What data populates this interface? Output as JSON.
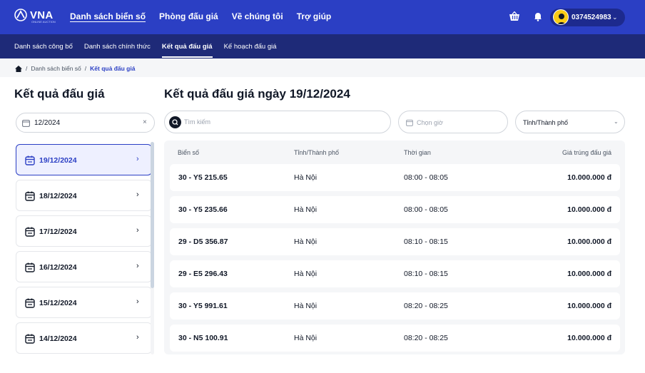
{
  "brand": {
    "name": "VNA",
    "tagline": "ONLINE AUCTION"
  },
  "topnav": [
    {
      "label": "Danh sách biển số",
      "active": true
    },
    {
      "label": "Phòng đấu giá",
      "active": false
    },
    {
      "label": "Về chúng tôi",
      "active": false
    },
    {
      "label": "Trợ giúp",
      "active": false
    }
  ],
  "user": {
    "phone": "0374524983",
    "caret": "⌄"
  },
  "subnav": [
    {
      "label": "Danh sách công bố",
      "active": false
    },
    {
      "label": "Danh sách chính thức",
      "active": false
    },
    {
      "label": "Kết quả đấu giá",
      "active": true
    },
    {
      "label": "Kế hoạch đấu giá",
      "active": false
    }
  ],
  "breadcrumb": {
    "sep": "/",
    "items": [
      "Danh sách biển số",
      "Kết quả đấu giá"
    ]
  },
  "left": {
    "title": "Kết quả đấu giá",
    "month_filter": "12/2024",
    "clear": "×",
    "dates": [
      "19/12/2024",
      "18/12/2024",
      "17/12/2024",
      "16/12/2024",
      "15/12/2024",
      "14/12/2024"
    ],
    "selected_index": 0
  },
  "main": {
    "title": "Kết quả đấu giá ngày 19/12/2024",
    "search_placeholder": "Tìm kiếm",
    "time_placeholder": "Chọn giờ",
    "city_select": "Tỉnh/Thành phố",
    "columns": [
      "Biển số",
      "Tỉnh/Thành phố",
      "Thời gian",
      "Giá trúng đấu giá"
    ],
    "rows": [
      {
        "plate": "30 - Y5 215.65",
        "city": "Hà Nội",
        "time": "08:00 - 08:05",
        "price": "10.000.000 đ"
      },
      {
        "plate": "30 - Y5 235.66",
        "city": "Hà Nội",
        "time": "08:00 - 08:05",
        "price": "10.000.000 đ"
      },
      {
        "plate": "29 - D5 356.87",
        "city": "Hà Nội",
        "time": "08:10 - 08:15",
        "price": "10.000.000 đ"
      },
      {
        "plate": "29 - E5 296.43",
        "city": "Hà Nội",
        "time": "08:10 - 08:15",
        "price": "10.000.000 đ"
      },
      {
        "plate": "30 - Y5 991.61",
        "city": "Hà Nội",
        "time": "08:20 - 08:25",
        "price": "10.000.000 đ"
      },
      {
        "plate": "30 - N5 100.91",
        "city": "Hà Nội",
        "time": "08:20 - 08:25",
        "price": "10.000.000 đ"
      }
    ]
  },
  "colors": {
    "primary": "#2b3fc4",
    "navy": "#1e2a78",
    "panel": "#f5f6f8"
  },
  "icons": [
    "home-icon",
    "calendar-icon",
    "search-icon",
    "clock-icon",
    "cart-icon",
    "bell-icon",
    "chevron-right-icon"
  ]
}
